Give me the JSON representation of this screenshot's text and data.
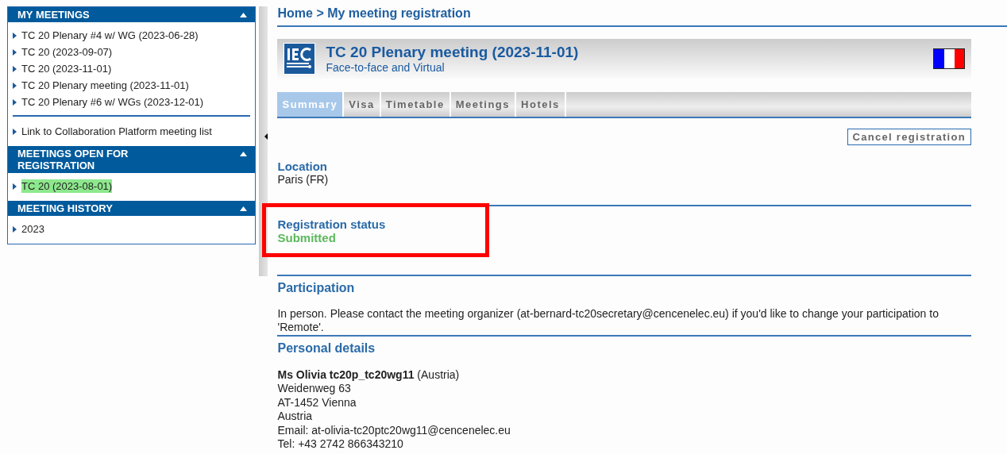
{
  "sidebar": {
    "sections": [
      {
        "title": "MY MEETINGS",
        "expanded": true,
        "groups": [
          [
            {
              "label": "TC 20 Plenary #4 w/ WG (2023-06-28)",
              "highlighted": false
            },
            {
              "label": "TC 20 (2023-09-07)",
              "highlighted": false
            },
            {
              "label": "TC 20 (2023-11-01)",
              "highlighted": false
            },
            {
              "label": "TC 20 Plenary meeting (2023-11-01)",
              "highlighted": false
            },
            {
              "label": "TC 20 Plenary #6 w/ WGs (2023-12-01)",
              "highlighted": false
            }
          ],
          [
            {
              "label": "Link to Collaboration Platform meeting list",
              "highlighted": false
            }
          ]
        ]
      },
      {
        "title": "MEETINGS OPEN FOR REGISTRATION",
        "expanded": true,
        "groups": [
          [
            {
              "label": "TC 20 (2023-08-01)",
              "highlighted": true
            }
          ]
        ]
      },
      {
        "title": "MEETING HISTORY",
        "expanded": true,
        "groups": [
          [
            {
              "label": "2023",
              "highlighted": false
            }
          ]
        ]
      }
    ]
  },
  "breadcrumb": "Home > My meeting registration",
  "meeting": {
    "title": "TC 20 Plenary meeting (2023-11-01)",
    "subtitle": "Face-to-face and Virtual"
  },
  "tabs": [
    {
      "label": "Summary",
      "selected": true
    },
    {
      "label": "Visa",
      "selected": false
    },
    {
      "label": "Timetable",
      "selected": false
    },
    {
      "label": "Meetings",
      "selected": false
    },
    {
      "label": "Hotels",
      "selected": false
    }
  ],
  "cancel_button": "Cancel registration",
  "location": {
    "heading": "Location",
    "value": "Paris (FR)"
  },
  "registration_status": {
    "heading": "Registration status",
    "value": "Submitted"
  },
  "participation": {
    "heading": "Participation",
    "text": "In person. Please contact the meeting organizer (at-bernard-tc20secretary@cencenelec.eu) if you'd like to change your participation to 'Remote'."
  },
  "personal_details": {
    "heading": "Personal details",
    "lines": [
      "**Ms Olivia tc20p_tc20wg11** (Austria)",
      "Weidenweg 63",
      "AT-1452 Vienna",
      "Austria",
      "Email: at-olivia-tc20ptc20wg11@cencenelec.eu",
      "Tel: +43 2742 866343210"
    ]
  }
}
